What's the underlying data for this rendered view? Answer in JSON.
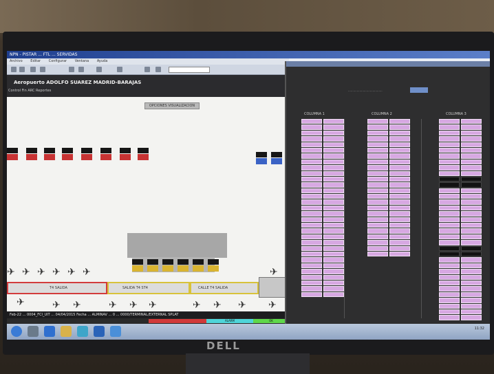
{
  "app": {
    "title": "NPN - PISTAR ... FTL ... SERVIDAS",
    "menu": [
      "Archivo",
      "Editar",
      "Configurar",
      "Ventana",
      "Ayuda"
    ],
    "airport_title": "Aeropuerto ADOLFO SUAREZ MADRID-BARAJAS",
    "airport_subtitle": "Control Fin ARC Reportes",
    "center_button": "OPCIONES VISUALIZACION",
    "taxiways": [
      "T4 SALIDA",
      "SALIDA T4 ST4",
      "CALLE T4 SALIDA"
    ],
    "status_line": "Feb-22 ... 0004_FCI_UIT ... 04/04/2015 Fecha ... ALMINAV ... 0 ... 0000/TERMINAL/EXTERNAL SPLAT",
    "status_segments": [
      {
        "label": "",
        "color": "#2b2b2b"
      },
      {
        "label": "",
        "color": "#2b2b2b"
      },
      {
        "label": "",
        "color": "#d13a3a"
      },
      {
        "label": "ALARM",
        "color": "#4fd5d9"
      },
      {
        "label": "OK",
        "color": "#5fd84a"
      }
    ],
    "clock": "11:32"
  },
  "panel": {
    "columns": [
      "COLUMNA 1",
      "COLUMNA 2",
      "COLUMNA 3"
    ]
  }
}
